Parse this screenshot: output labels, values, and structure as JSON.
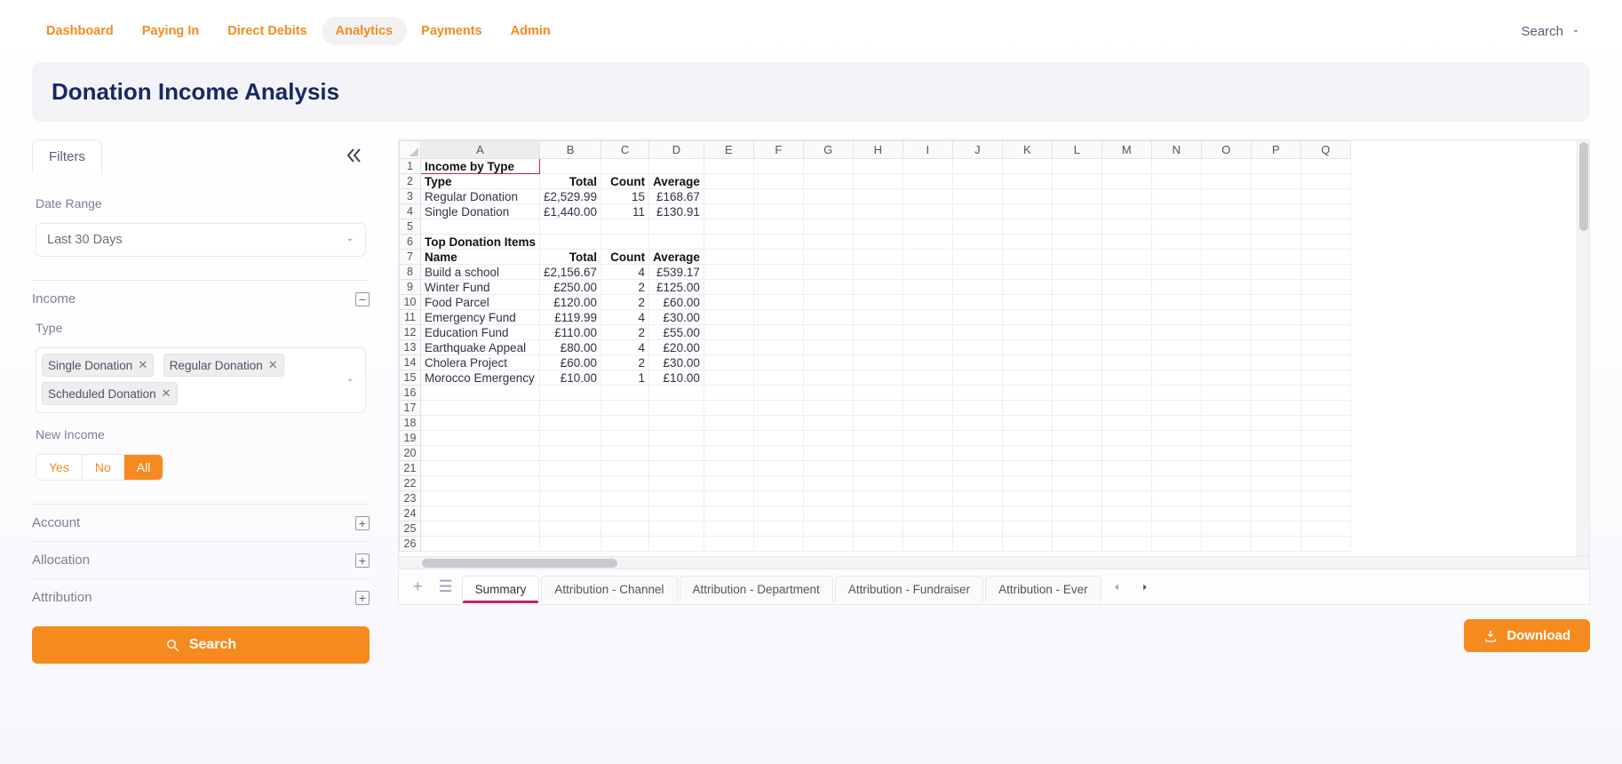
{
  "nav": {
    "items": [
      "Dashboard",
      "Paying In",
      "Direct Debits",
      "Analytics",
      "Payments",
      "Admin"
    ],
    "active": 3,
    "search_label": "Search"
  },
  "page": {
    "title": "Donation Income Analysis"
  },
  "filters": {
    "tab_label": "Filters",
    "date_label": "Date Range",
    "date_value": "Last 30 Days",
    "income_label": "Income",
    "type_label": "Type",
    "type_tags": [
      "Single Donation",
      "Regular Donation",
      "Scheduled Donation"
    ],
    "new_income_label": "New Income",
    "segments": [
      "Yes",
      "No",
      "All"
    ],
    "segment_selected": 2,
    "account_label": "Account",
    "allocation_label": "Allocation",
    "attribution_label": "Attribution",
    "search_button": "Search"
  },
  "spreadsheet": {
    "columns": [
      "A",
      "B",
      "C",
      "D",
      "E",
      "F",
      "G",
      "H",
      "I",
      "J",
      "K",
      "L",
      "M",
      "N",
      "O",
      "P",
      "Q"
    ],
    "visible_rows": 26,
    "section1_title": "Income by Type",
    "section1_headers": [
      "Type",
      "Total",
      "Count",
      "Average"
    ],
    "section1_rows": [
      {
        "type": "Regular Donation",
        "total": "£2,529.99",
        "count": "15",
        "avg": "£168.67"
      },
      {
        "type": "Single Donation",
        "total": "£1,440.00",
        "count": "11",
        "avg": "£130.91"
      }
    ],
    "section2_title": "Top Donation Items",
    "section2_headers": [
      "Name",
      "Total",
      "Count",
      "Average"
    ],
    "section2_rows": [
      {
        "name": "Build a school",
        "total": "£2,156.67",
        "count": "4",
        "avg": "£539.17"
      },
      {
        "name": "Winter Fund",
        "total": "£250.00",
        "count": "2",
        "avg": "£125.00"
      },
      {
        "name": "Food Parcel",
        "total": "£120.00",
        "count": "2",
        "avg": "£60.00"
      },
      {
        "name": "Emergency Fund",
        "total": "£119.99",
        "count": "4",
        "avg": "£30.00"
      },
      {
        "name": "Education Fund",
        "total": "£110.00",
        "count": "2",
        "avg": "£55.00"
      },
      {
        "name": "Earthquake Appeal",
        "total": "£80.00",
        "count": "4",
        "avg": "£20.00"
      },
      {
        "name": "Cholera Project",
        "total": "£60.00",
        "count": "2",
        "avg": "£30.00"
      },
      {
        "name": "Morocco Emergency",
        "total": "£10.00",
        "count": "1",
        "avg": "£10.00"
      }
    ],
    "tabs": [
      "Summary",
      "Attribution - Channel",
      "Attribution - Department",
      "Attribution - Fundraiser",
      "Attribution - Ever"
    ],
    "active_tab": 0
  },
  "download_label": "Download"
}
